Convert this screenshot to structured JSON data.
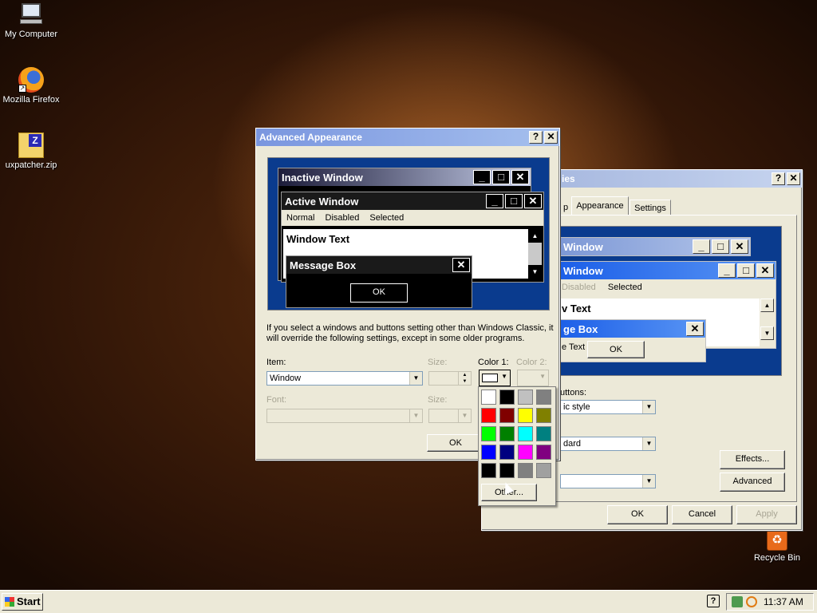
{
  "desktop": {
    "icons": [
      {
        "label": "My Computer",
        "icon": "computer-icon"
      },
      {
        "label": "Mozilla Firefox",
        "icon": "firefox-icon"
      },
      {
        "label": "uxpatcher.zip",
        "icon": "zip-icon"
      },
      {
        "label": "Recycle Bin",
        "icon": "recycle-bin-icon"
      }
    ]
  },
  "display_props": {
    "title_partial": "ies",
    "tabs": [
      "p",
      "Appearance",
      "Settings"
    ],
    "active_tab": "Appearance",
    "preview": {
      "inactive_title": "Window",
      "active_title": "Window",
      "menu_items": [
        "Disabled",
        "Selected"
      ],
      "window_text": "v Text",
      "msgbox_title": "ge Box",
      "msgbox_text": "e Text",
      "msgbox_ok": "OK"
    },
    "buttons_label": "uttons:",
    "style_value": "ic style",
    "scheme_value": "dard",
    "font_size_value": "",
    "effects_btn": "Effects...",
    "advanced_btn": "Advanced",
    "ok": "OK",
    "cancel": "Cancel",
    "apply": "Apply"
  },
  "advanced": {
    "title": "Advanced Appearance",
    "help_btn": "?",
    "close_btn": "✕",
    "preview": {
      "inactive_title": "Inactive Window",
      "active_title": "Active Window",
      "menu_items": [
        "Normal",
        "Disabled",
        "Selected"
      ],
      "window_text": "Window Text",
      "msgbox_title": "Message Box",
      "msgbox_ok": "OK"
    },
    "note": "If you select a windows and buttons setting other than Windows Classic, it will override the following settings, except in some older programs.",
    "item_label": "Item:",
    "item_value": "Window",
    "size_label": "Size:",
    "color1_label": "Color 1:",
    "color2_label": "Color 2:",
    "font_label": "Font:",
    "size2_label": "Size:",
    "ok": "OK"
  },
  "color_picker": {
    "swatches": [
      "#ffffff",
      "#000000",
      "#c0c0c0",
      "#808080",
      "#ff0000",
      "#800000",
      "#ffff00",
      "#808000",
      "#00ff00",
      "#008000",
      "#00ffff",
      "#008080",
      "#0000ff",
      "#000080",
      "#ff00ff",
      "#800080",
      "#000000",
      "#000000",
      "#808080",
      "#a0a0a0"
    ],
    "other_btn": "Other..."
  },
  "taskbar": {
    "start": "Start",
    "clock": "11:37 AM"
  },
  "colors": {
    "active_title": "#7a96df",
    "preview_bg": "#0a3b8e",
    "active_blue": "#2a6ff0"
  }
}
